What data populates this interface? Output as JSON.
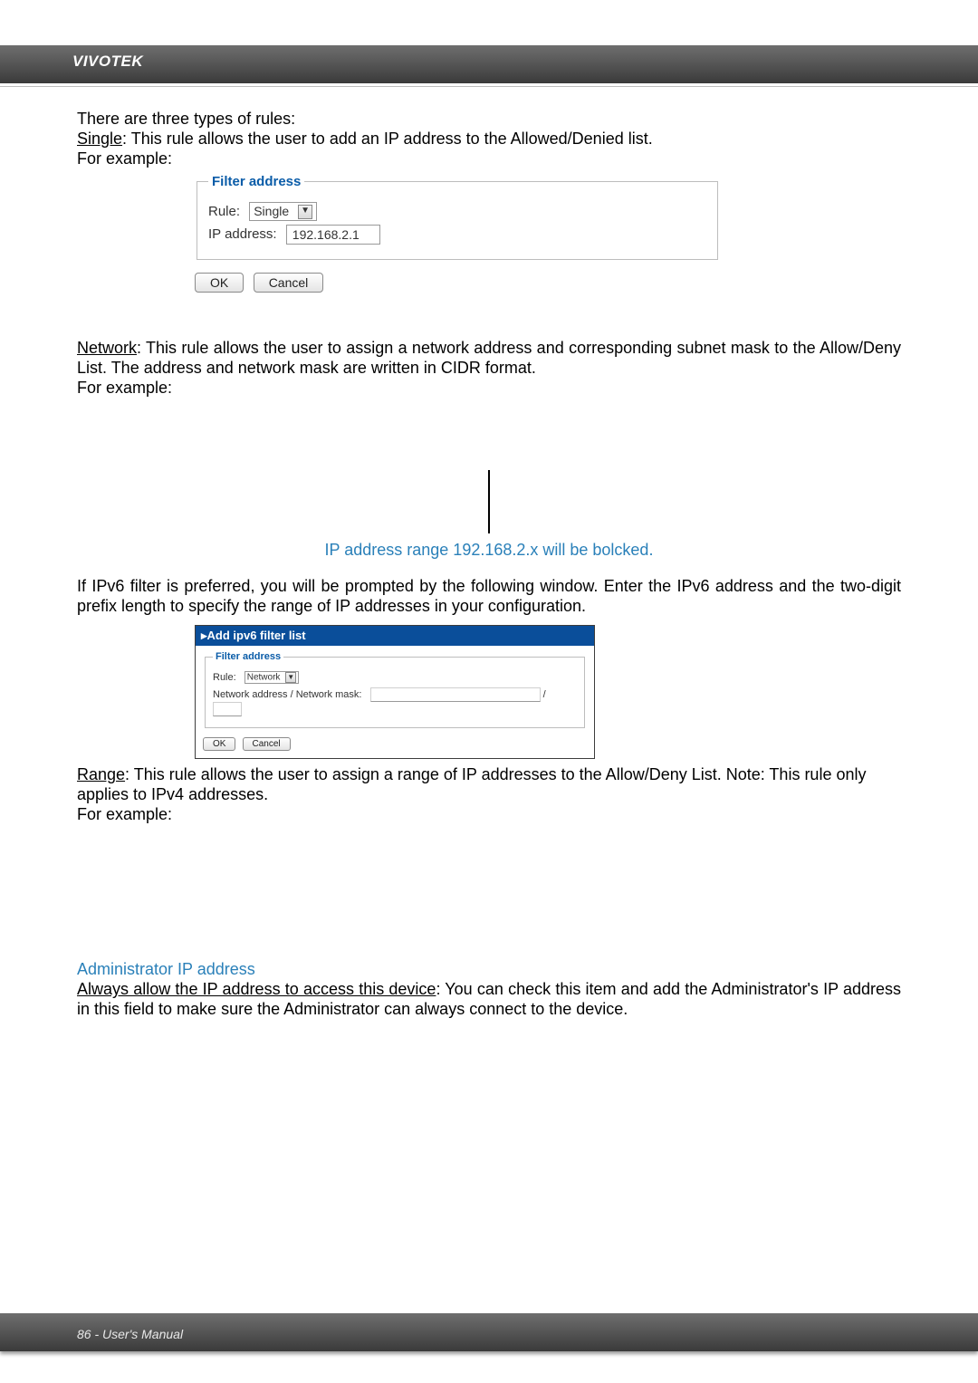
{
  "brand": "VIVOTEK",
  "intro": "There are three types of rules:",
  "single_label": "Single",
  "single_text": ": This rule allows the user to add an IP address to the Allowed/Denied list.",
  "for_example": "For example:",
  "filter_legend": "Filter address",
  "rule_label": "Rule:",
  "rule_single_value": "Single",
  "ip_label": "IP address:",
  "ip_value": "192.168.2.1",
  "ok": "OK",
  "cancel": "Cancel",
  "network_label": "Network",
  "network_text": ": This rule allows the user to assign a network address and corresponding subnet mask to the Allow/Deny List. The address and network mask are written in CIDR format.",
  "ip_range_caption": "IP address range 192.168.2.x will be bolcked.",
  "ipv6_intro": "If IPv6 filter is preferred, you will be prompted by the following window. Enter the IPv6 address and the two-digit prefix length to specify the range of IP addresses in your configuration.",
  "ipv6_title": "▸Add ipv6 filter list",
  "rule_network_value": "Network",
  "netaddr_label": "Network address / Network mask:",
  "slash": "/",
  "range_label": "Range",
  "range_text": ": This rule allows the user to assign a range of IP addresses to the Allow/Deny List. Note: This rule only applies to IPv4 addresses.",
  "admin_head": "Administrator IP address",
  "admin_label": "Always allow the IP address to access this device",
  "admin_text": ": You can check this item and add the Administrator's IP address in this field to make sure the Administrator can always connect to the device.",
  "footer": "86 - User's Manual"
}
